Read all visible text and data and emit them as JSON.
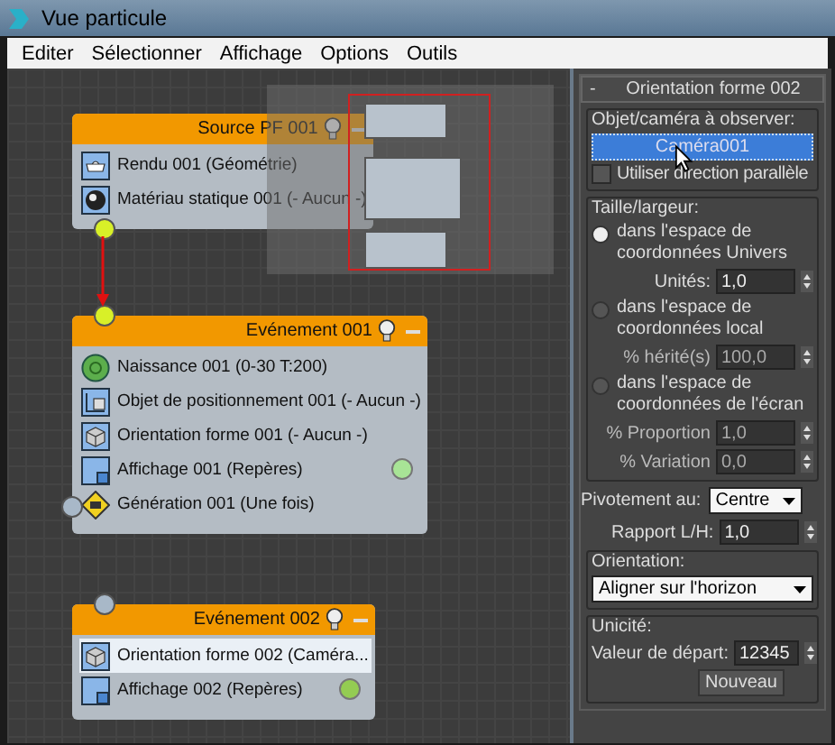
{
  "window": {
    "title": "Vue particule"
  },
  "menu": [
    {
      "label": "Editer"
    },
    {
      "label": "Sélectionner"
    },
    {
      "label": "Affichage"
    },
    {
      "label": "Options"
    },
    {
      "label": "Outils"
    }
  ],
  "nodes": [
    {
      "title": "Source PF 001",
      "input_port": false,
      "output_port": true,
      "items": [
        {
          "kind": "render",
          "text": "Rendu 001 (Géométrie)",
          "selected": false
        },
        {
          "kind": "material",
          "text": "Matériau statique 001 (- Aucun -)",
          "selected": false
        }
      ]
    },
    {
      "title": "Evénement 001",
      "input_port": true,
      "input_connected": true,
      "items": [
        {
          "kind": "birth",
          "text": "Naissance 001 (0-30 T:200)",
          "selected": false
        },
        {
          "kind": "position",
          "text": "Objet de positionnement 001 (- Aucun -)",
          "selected": false
        },
        {
          "kind": "shape",
          "text": "Orientation forme 001 (- Aucun -)",
          "selected": false
        },
        {
          "kind": "display",
          "text": "Affichage 001 (Repères)",
          "selected": false,
          "color": "#a8e496"
        },
        {
          "kind": "spawn",
          "text": "Génération 001 (Une fois)",
          "selected": false,
          "port": true
        }
      ]
    },
    {
      "title": "Evénement 002",
      "input_port": true,
      "input_connected": false,
      "items": [
        {
          "kind": "shape",
          "text": "Orientation forme 002 (Caméra...",
          "selected": true
        },
        {
          "kind": "display",
          "text": "Affichage 002 (Repères)",
          "selected": false,
          "color": "#94cc52"
        }
      ]
    }
  ],
  "panel": {
    "rollout": {
      "sign": "-",
      "title": "Orientation forme 002"
    },
    "target_group": {
      "label": "Objet/caméra à observer:",
      "button": "Caméra001",
      "checkbox": {
        "label": "Utiliser direction parallèle",
        "checked": false
      }
    },
    "size_group": {
      "label": "Taille/largeur:",
      "options": [
        {
          "label": "dans l'espace de coordonnées Univers",
          "selected": true,
          "spinners": [
            {
              "label": "Unités:",
              "value": "1,0",
              "disabled": false
            }
          ]
        },
        {
          "label": "dans l'espace de coordonnées local",
          "selected": false,
          "spinners": [
            {
              "label": "% hérité(s)",
              "value": "100,0",
              "disabled": true
            }
          ]
        },
        {
          "label": "dans l'espace de coordonnées de l'écran",
          "selected": false,
          "spinners": [
            {
              "label": "% Proportion",
              "value": "1,0",
              "disabled": true
            },
            {
              "label": "% Variation",
              "value": "0,0",
              "disabled": true
            }
          ]
        }
      ]
    },
    "pivot": {
      "label": "Pivotement au:",
      "value": "Centre"
    },
    "ratio": {
      "label": "Rapport L/H:",
      "value": "1,0"
    },
    "orientation_group": {
      "label": "Orientation:",
      "value": "Aligner sur l'horizon"
    },
    "unique_group": {
      "label": "Unicité:",
      "seed_label": "Valeur de départ:",
      "seed": "12345",
      "button": "Nouveau"
    }
  }
}
